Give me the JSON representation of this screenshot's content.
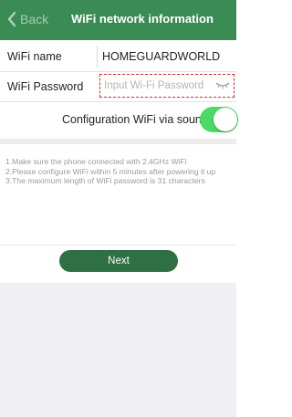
{
  "header": {
    "back_label": "Back",
    "title": "WiFi network information"
  },
  "form": {
    "wifi_name_label": "WiFi name",
    "wifi_name_value": "HOMEGUARDWORLD",
    "wifi_password_label": "WiFi Password",
    "wifi_password_placeholder": "Input Wi-Fi Password",
    "wifi_password_value": "",
    "sound_label": "Configuration WiFi via sound",
    "sound_enabled": true
  },
  "notes": [
    "1.Make sure the phone connected with 2.4GHz WiFi",
    "2.Please configure WiFi within 5 minutes after powering it up",
    "3.The maximum length of WiFi password is 31 characters"
  ],
  "actions": {
    "next_label": "Next"
  },
  "colors": {
    "header": "#3b8b55",
    "toggle_on": "#4cd964",
    "next_button": "#2e6f44",
    "highlight_border": "#e02a2a"
  },
  "icons": {
    "back": "chevron-left-icon",
    "password_visibility": "eye-closed-icon"
  }
}
